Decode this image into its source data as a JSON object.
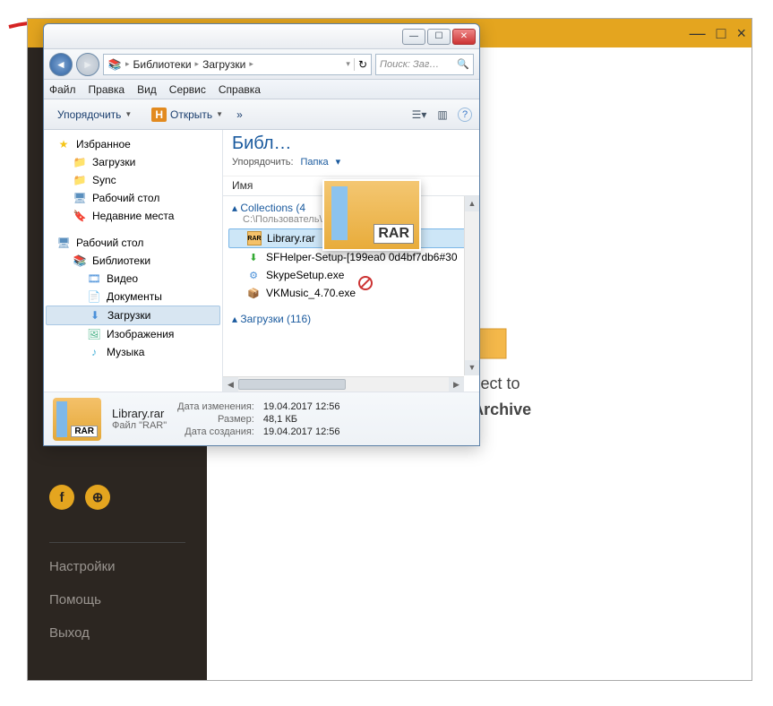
{
  "bgApp": {
    "minimize": "—",
    "maximize": "□",
    "close": "×",
    "dropText1": "or Select to",
    "dropText2": "Open Archive",
    "sidebar": {
      "facebook": "f",
      "globe": "⊕",
      "settings": "Настройки",
      "help": "Помощь",
      "exit": "Выход"
    }
  },
  "explorer": {
    "back": "◄",
    "fwd": "►",
    "breadcrumbIcon": "▸",
    "crumb1": "Библиотеки",
    "crumb2": "Загрузки",
    "refresh": "↻",
    "searchPlaceholder": "Поиск: Заг…",
    "searchIcon": "🔍",
    "menu": {
      "file": "Файл",
      "edit": "Правка",
      "view": "Вид",
      "tools": "Сервис",
      "help": "Справка"
    },
    "toolbar": {
      "organize": "Упорядочить",
      "openBadge": "H",
      "open": "Открыть",
      "more": "»",
      "viewIcon": "☰",
      "previewIcon": "▥",
      "helpIcon": "?"
    },
    "tree": {
      "favorites": "Избранное",
      "downloads": "Загрузки",
      "sync": "Sync",
      "desktop": "Рабочий стол",
      "recent": "Недавние места",
      "desktop2": "Рабочий стол",
      "libraries": "Библиотеки",
      "video": "Видео",
      "documents": "Документы",
      "downloads2": "Загрузки",
      "images": "Изображения",
      "music": "Музыка"
    },
    "list": {
      "title": "Библ…",
      "sortLabel": "Упорядочить:",
      "sortValue": "Папка",
      "colName": "Имя",
      "grp1": "Collections (4",
      "grp1Path": "C:\\Пользователь\\АПК\\Roami…",
      "file1": "Library.rar",
      "file2": "SFHelper-Setup-[199ea0    0d4bf7db6#30",
      "file3": "SkypeSetup.exe",
      "file4": "VKMusic_4.70.exe",
      "grp2": "Загрузки (116)"
    },
    "details": {
      "name": "Library.rar",
      "type": "Файл \"RAR\"",
      "modKey": "Дата изменения:",
      "modVal": "19.04.2017 12:56",
      "sizeKey": "Размер:",
      "sizeVal": "48,1 КБ",
      "createdKey": "Дата создания:",
      "createdVal": "19.04.2017 12:56"
    },
    "ghost": "RAR"
  }
}
